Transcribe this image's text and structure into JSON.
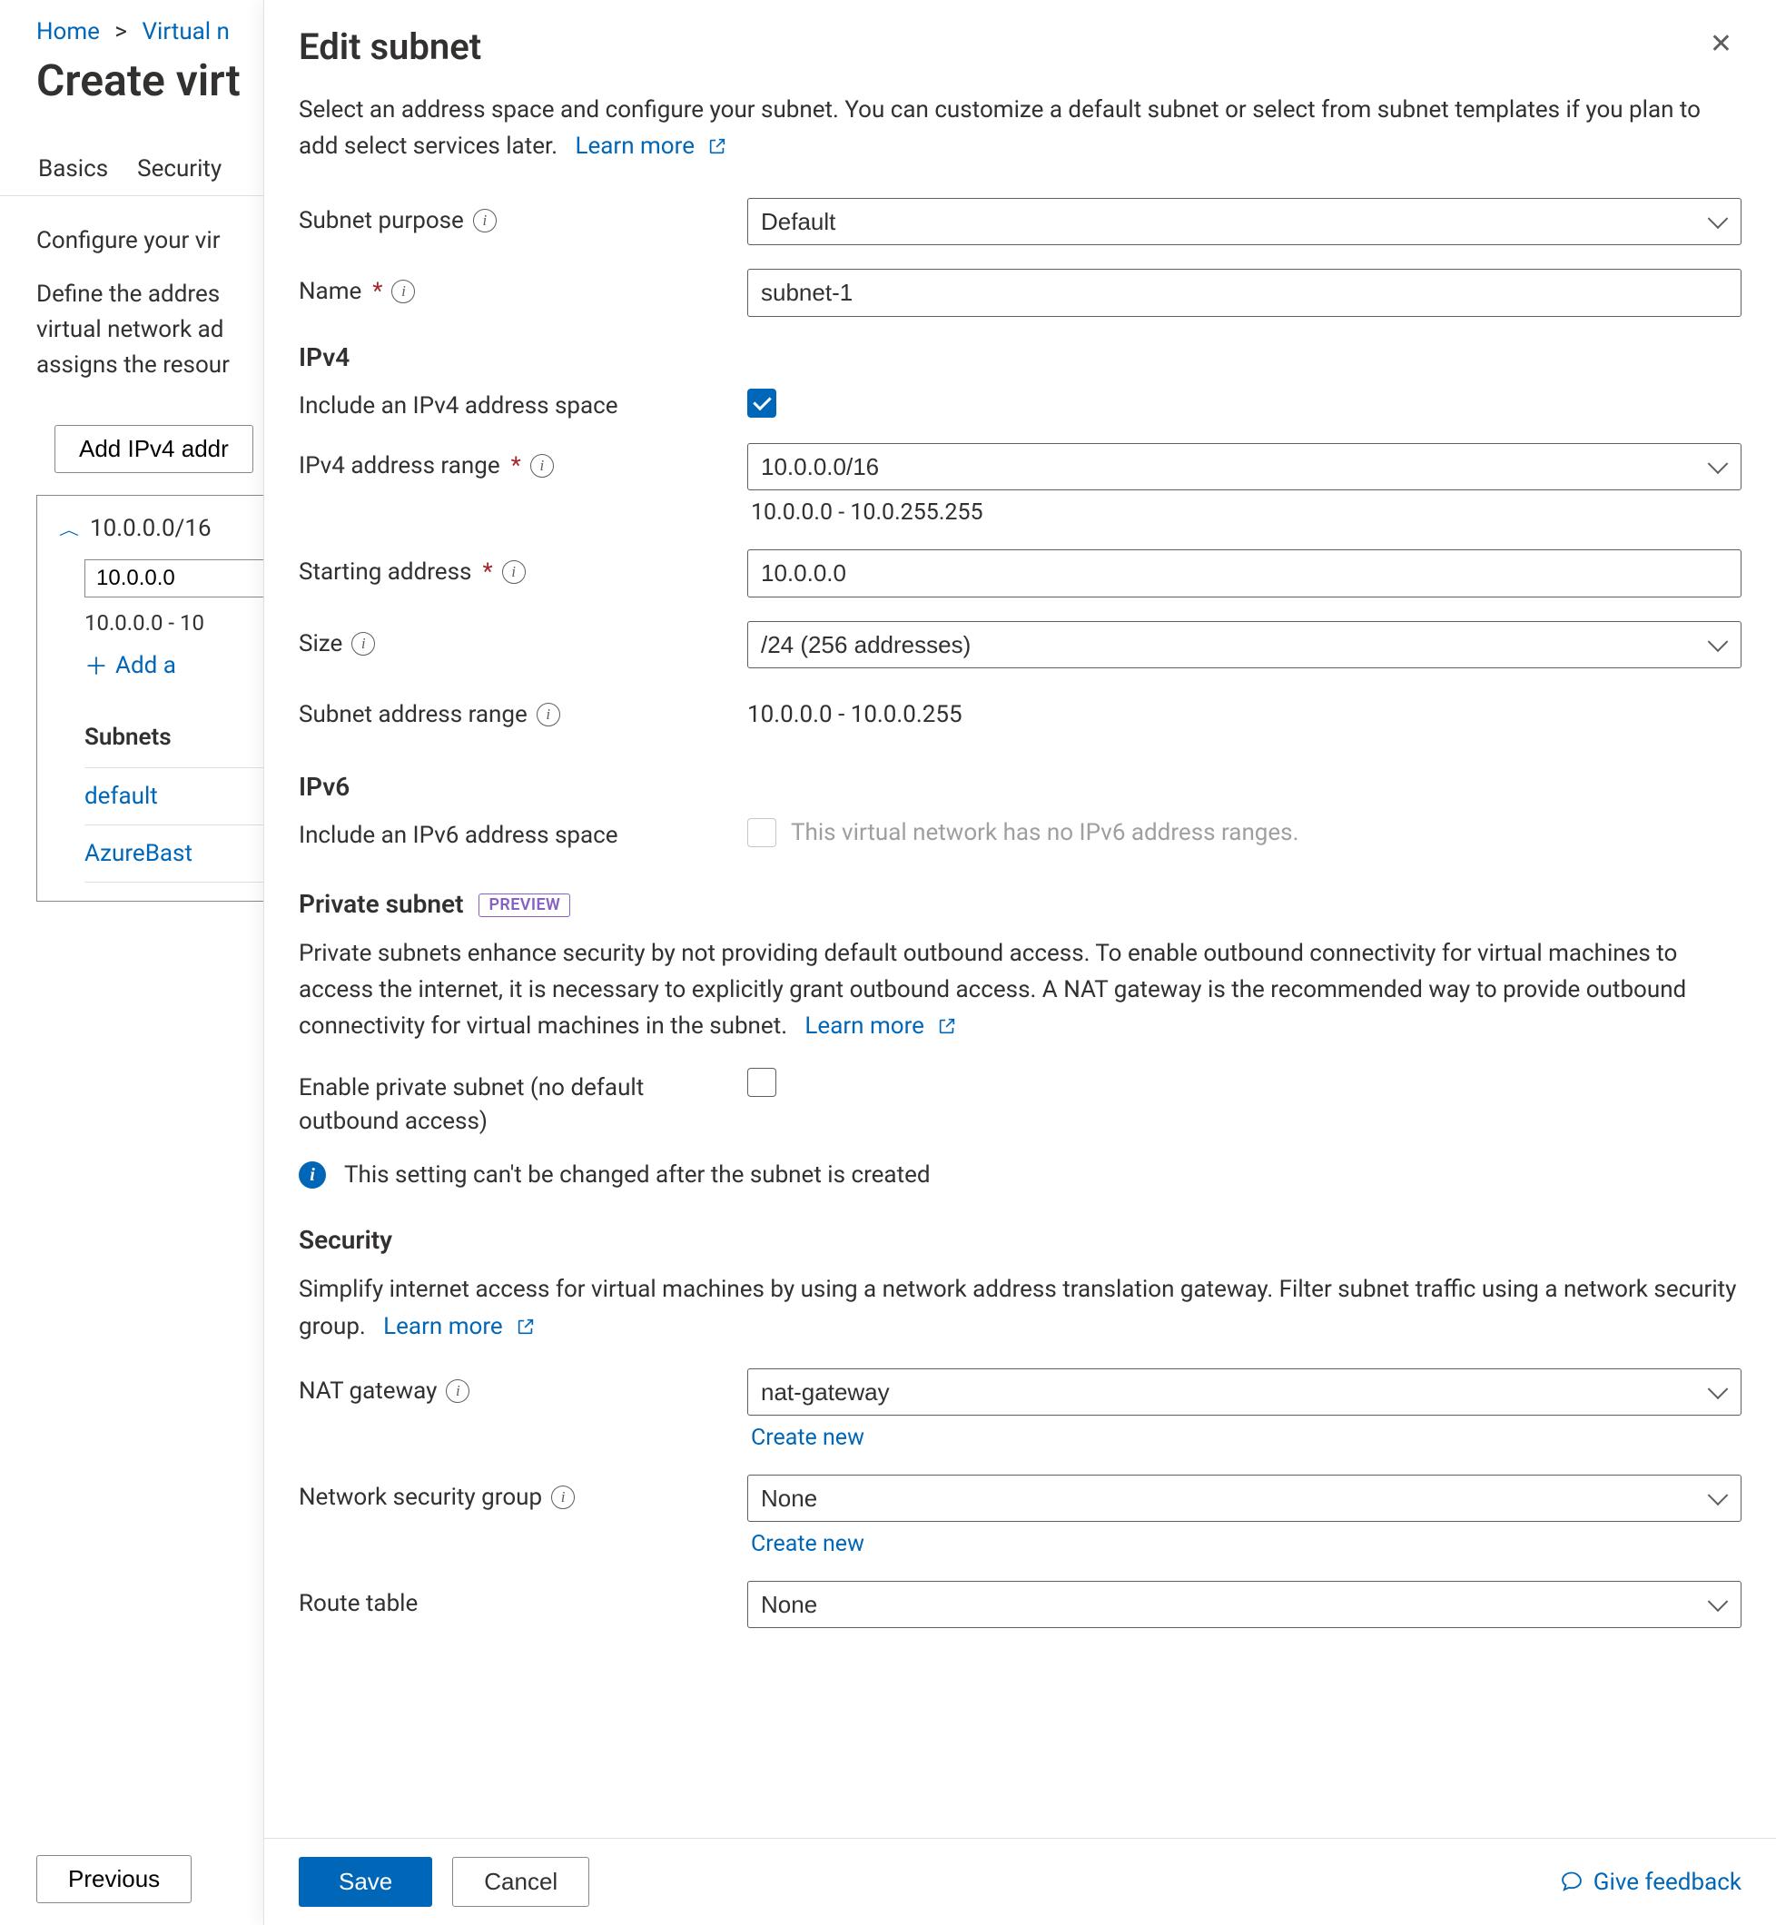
{
  "breadcrumb": {
    "home": "Home",
    "second": "Virtual n"
  },
  "page_title": "Create virt",
  "tabs": {
    "basics": "Basics",
    "security": "Security"
  },
  "bg": {
    "desc_l1": "Configure your vir",
    "desc_l2": "Define the addres",
    "desc_l3": "virtual network ad",
    "desc_l4": "assigns the resour",
    "add_btn": "Add IPv4 addr",
    "cidr": "10.0.0.0/16",
    "start_val": "10.0.0.0",
    "range_txt": "10.0.0.0 - 10",
    "add_subnet": "Add a",
    "subnets_hdr": "Subnets",
    "subnet1": "default",
    "subnet2": "AzureBast",
    "prev_btn": "Previous"
  },
  "panel": {
    "title": "Edit subnet",
    "intro": "Select an address space and configure your subnet. You can customize a default subnet or select from subnet templates if you plan to add select services later.",
    "learn_more": "Learn more",
    "fields": {
      "subnet_purpose_label": "Subnet purpose",
      "subnet_purpose_value": "Default",
      "name_label": "Name",
      "name_value": "subnet-1"
    },
    "ipv4": {
      "hdr": "IPv4",
      "include_label": "Include an IPv4 address space",
      "range_label": "IPv4 address range",
      "range_value": "10.0.0.0/16",
      "range_helper": "10.0.0.0 - 10.0.255.255",
      "start_label": "Starting address",
      "start_value": "10.0.0.0",
      "size_label": "Size",
      "size_value": "/24 (256 addresses)",
      "subnet_range_label": "Subnet address range",
      "subnet_range_value": "10.0.0.0 - 10.0.0.255"
    },
    "ipv6": {
      "hdr": "IPv6",
      "include_label": "Include an IPv6 address space",
      "disabled_text": "This virtual network has no IPv6 address ranges."
    },
    "private": {
      "hdr": "Private subnet",
      "pill": "PREVIEW",
      "desc": "Private subnets enhance security by not providing default outbound access. To enable outbound connectivity for virtual machines to access the internet, it is necessary to explicitly grant outbound access. A NAT gateway is the recommended way to provide outbound connectivity for virtual machines in the subnet.",
      "enable_label": "Enable private subnet (no default outbound access)",
      "info_text": "This setting can't be changed after the subnet is created"
    },
    "security": {
      "hdr": "Security",
      "desc": "Simplify internet access for virtual machines by using a network address translation gateway. Filter subnet traffic using a network security group.",
      "nat_label": "NAT gateway",
      "nat_value": "nat-gateway",
      "create_new": "Create new",
      "nsg_label": "Network security group",
      "nsg_value": "None",
      "route_label": "Route table",
      "route_value": "None"
    },
    "footer": {
      "save": "Save",
      "cancel": "Cancel",
      "feedback": "Give feedback"
    }
  }
}
